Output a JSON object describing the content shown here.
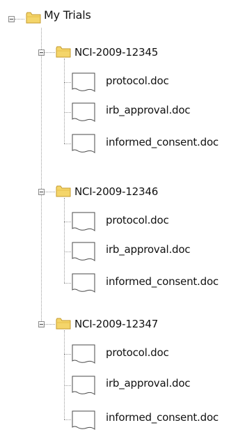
{
  "tree": {
    "root_label": "My Trials",
    "trials": [
      {
        "label": "NCI-2009-12345",
        "files": [
          "protocol.doc",
          "irb_approval.doc",
          "informed_consent.doc"
        ]
      },
      {
        "label": "NCI-2009-12346",
        "files": [
          "protocol.doc",
          "irb_approval.doc",
          "informed_consent.doc"
        ]
      },
      {
        "label": "NCI-2009-12347",
        "files": [
          "protocol.doc",
          "irb_approval.doc",
          "informed_consent.doc"
        ]
      }
    ]
  },
  "icons": {
    "root_toggle": "collapse-icon",
    "folder": "folder-icon",
    "file": "document-icon"
  },
  "colors": {
    "folder_fill": "#f4d56a",
    "folder_stroke": "#c49a2d",
    "line": "#9a9a9a"
  }
}
